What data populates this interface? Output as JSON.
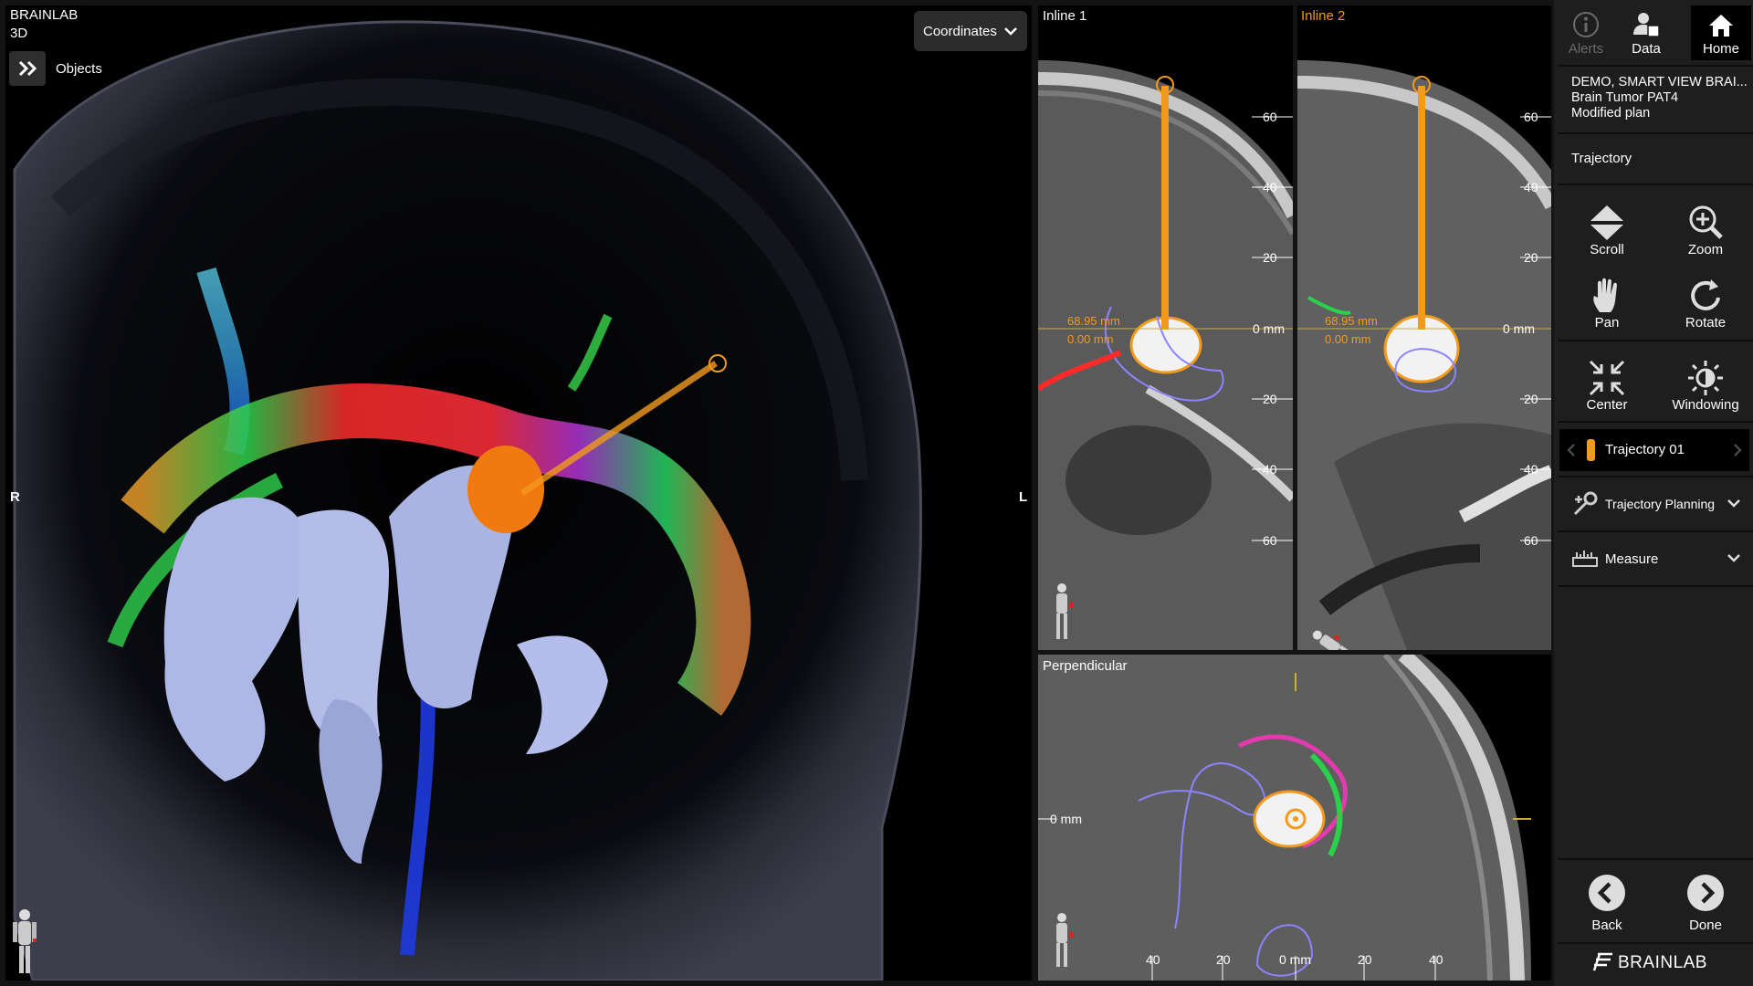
{
  "view3d": {
    "app_name": "BRAINLAB",
    "mode": "3D",
    "objects_label": "Objects",
    "coordinates_label": "Coordinates",
    "orientation_right": "R",
    "orientation_left": "L"
  },
  "inline1": {
    "title": "Inline 1",
    "ticks": [
      "60",
      "40",
      "20",
      "0 mm",
      "20",
      "40",
      "60"
    ],
    "measure1": "68.95 mm",
    "measure2": "0.00 mm"
  },
  "inline2": {
    "title": "Inline 2",
    "ticks": [
      "60",
      "40",
      "20",
      "0 mm",
      "20",
      "40",
      "60"
    ],
    "measure1": "68.95 mm",
    "measure2": "0.00 mm"
  },
  "perpendicular": {
    "title": "Perpendicular",
    "ylabel": "0 mm",
    "xticks": [
      "40",
      "20",
      "0 mm",
      "20",
      "40"
    ]
  },
  "sidebar": {
    "alerts_label": "Alerts",
    "data_label": "Data",
    "home_label": "Home",
    "patient_line1": "DEMO, SMART VIEW BRAI...",
    "patient_line2": "Brain Tumor PAT4",
    "patient_line3": "Modified plan",
    "section_title": "Trajectory",
    "tools": {
      "scroll": "Scroll",
      "zoom": "Zoom",
      "pan": "Pan",
      "rotate": "Rotate",
      "center": "Center",
      "windowing": "Windowing"
    },
    "trajectory_selector": "Trajectory 01",
    "trajectory_planning": "Trajectory Planning",
    "measure": "Measure",
    "back_label": "Back",
    "done_label": "Done",
    "brand": "BRAINLAB"
  },
  "colors": {
    "trajectory_orange": "#f29a1d",
    "panel_bg": "#1e1e1e",
    "viewport_bg": "#000000",
    "contour_purple": "#8c84ff"
  }
}
